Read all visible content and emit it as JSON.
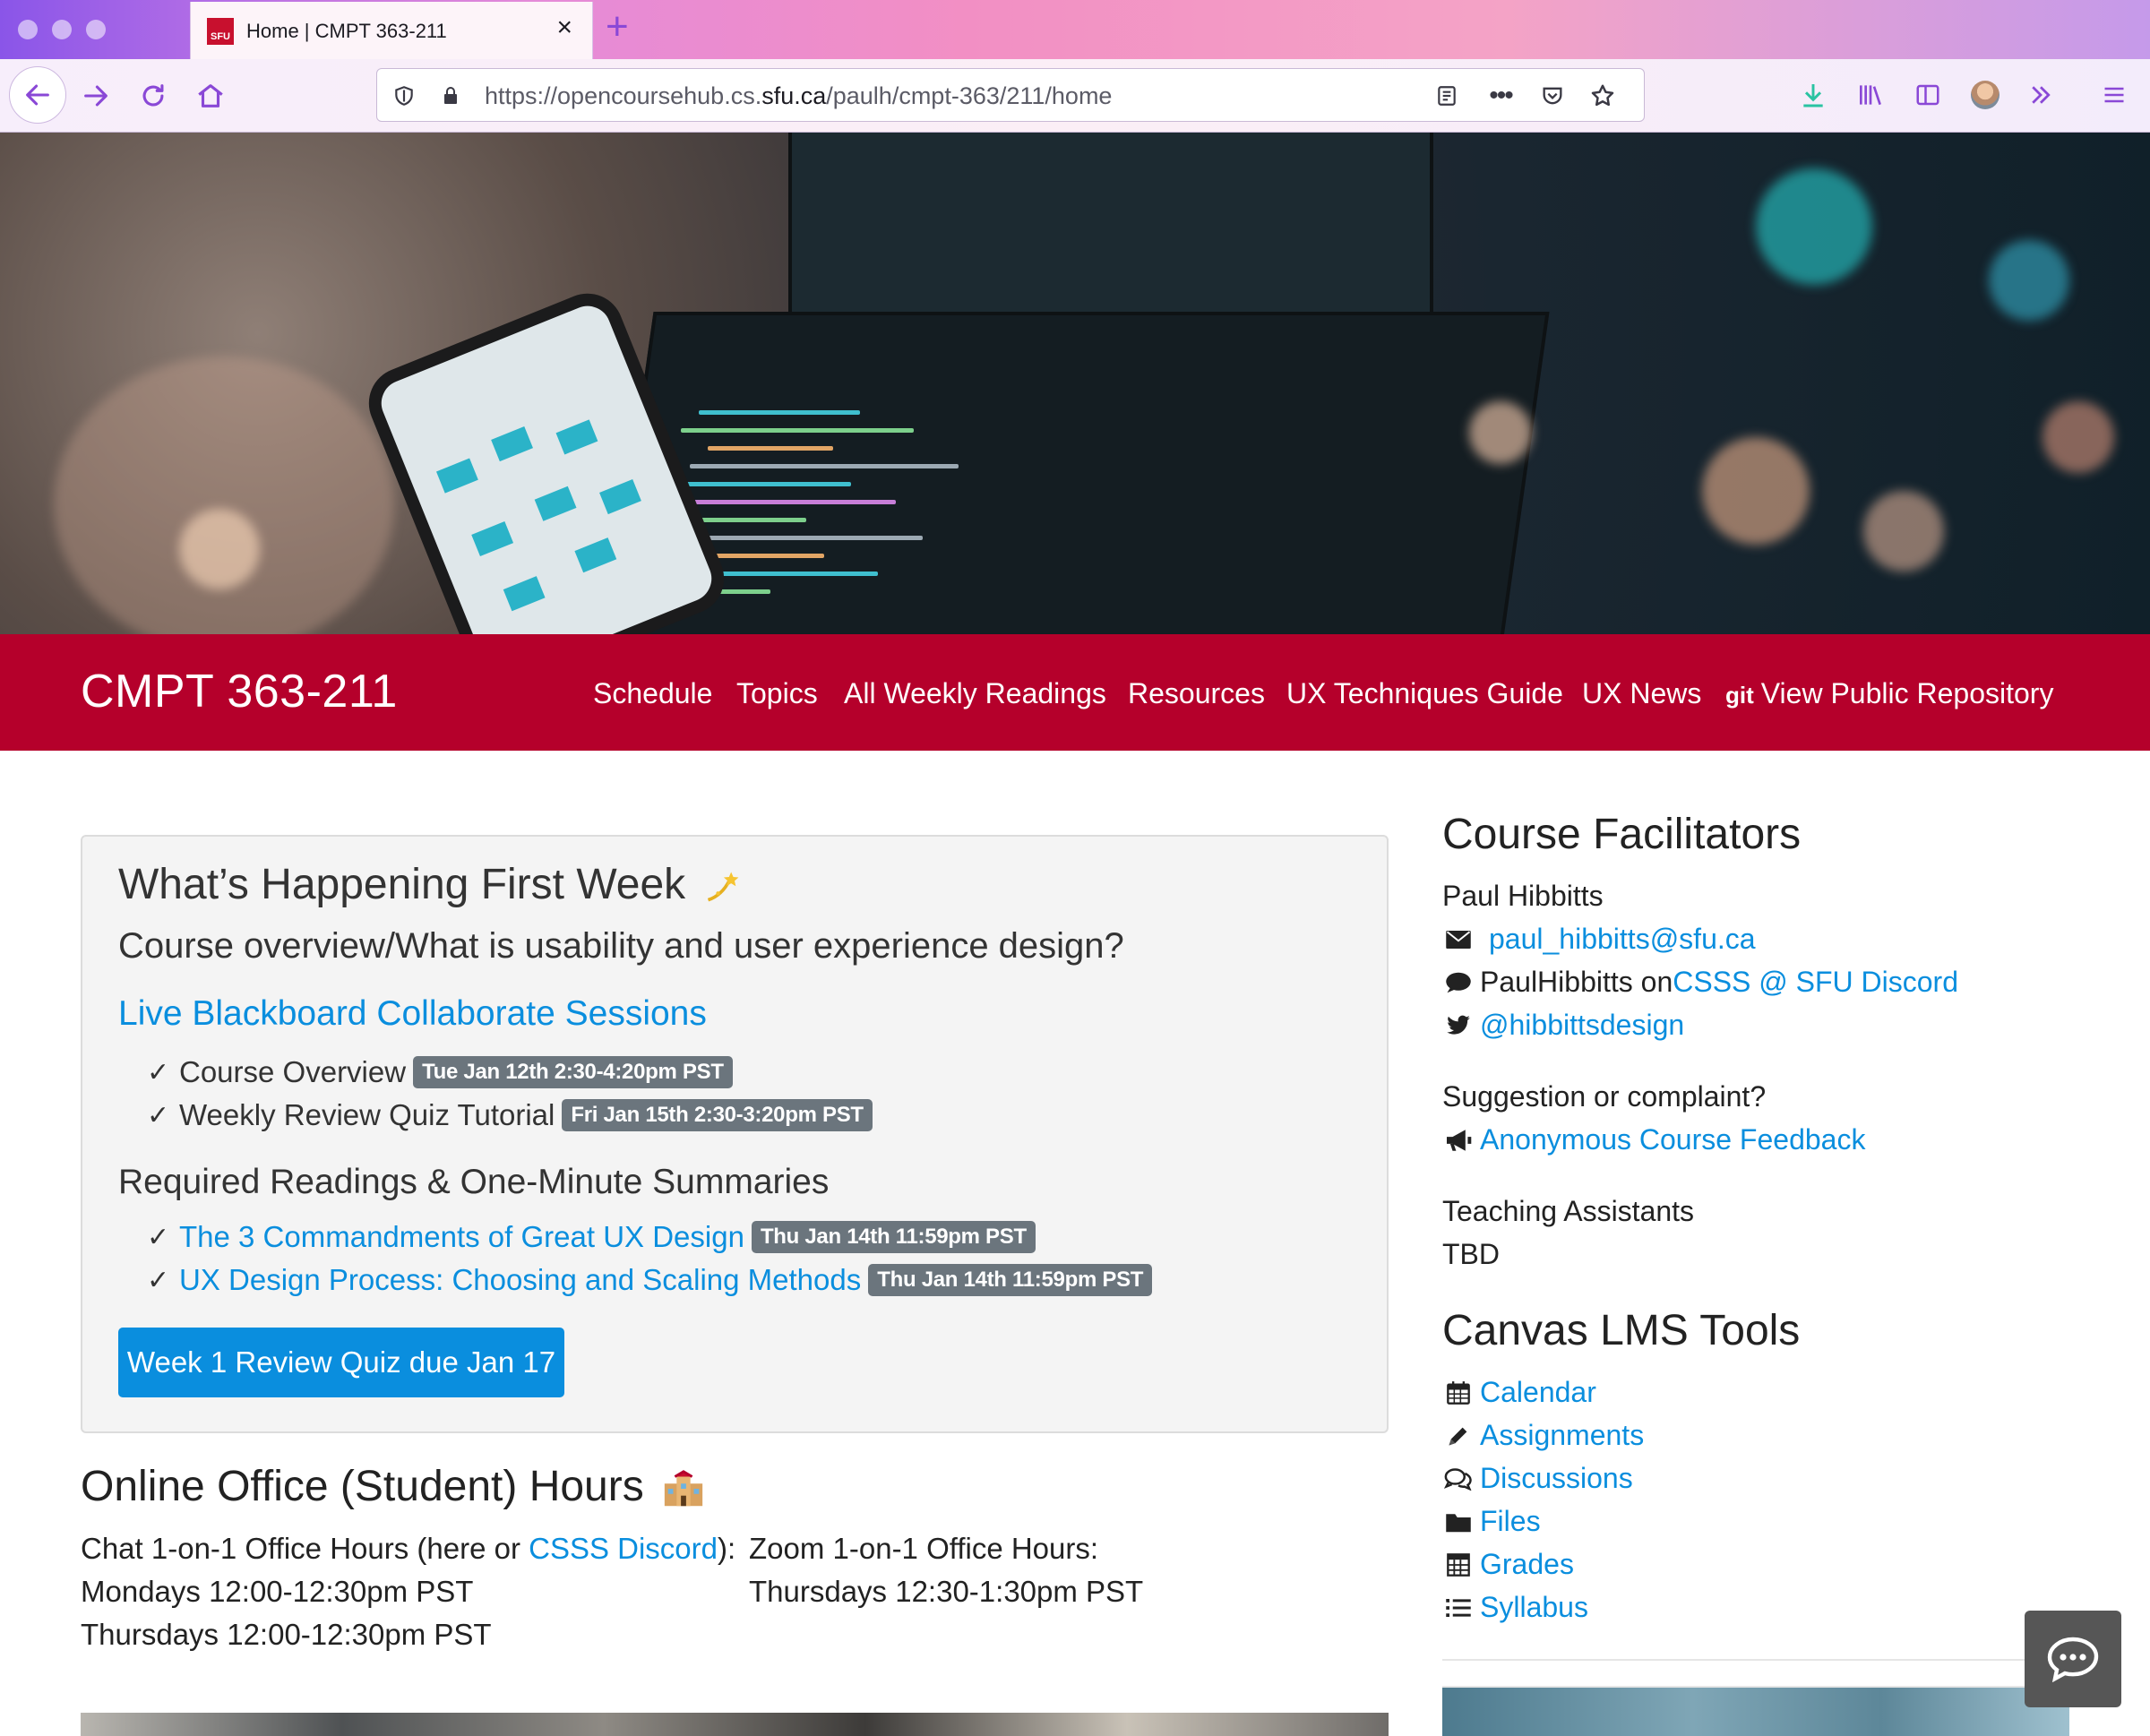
{
  "browser": {
    "tab_title": "Home | CMPT 363-211",
    "tab_favicon_text": "SFU",
    "url_prefix": "https://opencoursehub.cs.",
    "url_domain": "sfu.ca",
    "url_path": "/paulh/cmpt-363/211/home",
    "accent_color": "#8a48d6"
  },
  "course": {
    "title": "CMPT 363-211",
    "nav": [
      "Schedule",
      "Topics",
      "All Weekly Readings",
      "Resources",
      "UX Techniques Guide",
      "UX News",
      "View Public Repository"
    ],
    "git_label": "git",
    "brand_color": "#b5002b"
  },
  "first_week": {
    "heading": "What’s Happening First Week",
    "subheading": "Course overview/What is usability and user experience design?",
    "live_sessions_link": "Live Blackboard Collaborate Sessions",
    "sessions": [
      {
        "label": "Course Overview",
        "badge": "Tue Jan 12th 2:30-4:20pm PST"
      },
      {
        "label": "Weekly Review Quiz Tutorial",
        "badge": "Fri Jan 15th 2:30-3:20pm PST"
      }
    ],
    "readings_heading": "Required Readings & One-Minute Summaries",
    "readings": [
      {
        "label": "The 3 Commandments of Great UX Design",
        "badge": "Thu Jan 14th 11:59pm PST"
      },
      {
        "label": "UX Design Process: Choosing and Scaling Methods",
        "badge": "Thu Jan 14th 11:59pm PST"
      }
    ],
    "quiz_button": "Week 1 Review Quiz due Jan 17"
  },
  "office_hours": {
    "heading": "Online Office (Student) Hours",
    "chat_label_pre": "Chat 1-on-1 Office Hours (here or ",
    "chat_link": "CSSS Discord",
    "chat_label_post": "):",
    "chat_times": [
      "Mondays 12:00-12:30pm PST",
      "Thursdays 12:00-12:30pm PST"
    ],
    "zoom_label": "Zoom 1-on-1 Office Hours:",
    "zoom_link": "Thursdays 12:30-1:30pm PST"
  },
  "facilitators": {
    "heading": "Course Facilitators",
    "name": "Paul Hibbitts",
    "email": "paul_hibbitts@sfu.ca",
    "discord_pre": "PaulHibbitts on ",
    "discord_link": "CSSS @ SFU Discord",
    "twitter": "@hibbittsdesign",
    "suggestion_label": "Suggestion or complaint?",
    "feedback_link": "Anonymous Course Feedback",
    "ta_label": "Teaching Assistants",
    "ta_value": "TBD"
  },
  "canvas": {
    "heading": "Canvas LMS Tools",
    "items": [
      {
        "label": "Calendar",
        "icon": "calendar-icon"
      },
      {
        "label": "Assignments",
        "icon": "pencil-icon"
      },
      {
        "label": "Discussions",
        "icon": "comments-icon"
      },
      {
        "label": "Files",
        "icon": "folder-icon"
      },
      {
        "label": "Grades",
        "icon": "table-icon"
      },
      {
        "label": "Syllabus",
        "icon": "list-icon"
      }
    ]
  },
  "link_color": "#0a8ede"
}
